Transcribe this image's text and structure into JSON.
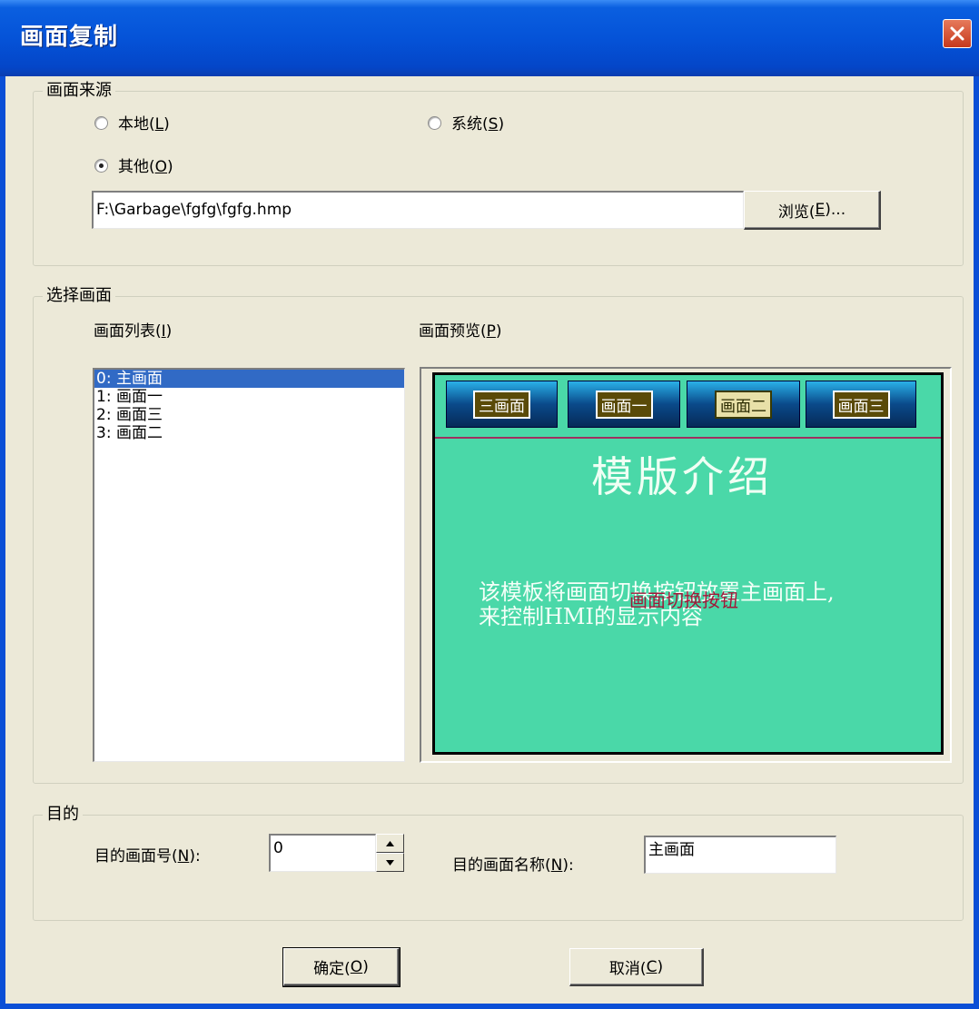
{
  "window": {
    "title": "画面复制",
    "close_icon": "close-icon"
  },
  "source": {
    "legend": "画面来源",
    "local": "本地(L)",
    "system": "系统(S)",
    "other": "其他(O)",
    "selected": "other",
    "path": "F:\\Garbage\\fgfg\\fgfg.hmp",
    "browse": "浏览(E)..."
  },
  "select": {
    "legend": "选择画面",
    "list_label": "画面列表(I)",
    "preview_label": "画面预览(P)",
    "items": [
      "0: 主画面",
      "1: 画面一",
      "2: 画面三",
      "3: 画面二"
    ],
    "selected_index": 0,
    "preview": {
      "nav": [
        "三画面",
        "画面一",
        "画面二",
        "画面三"
      ],
      "title": "模版介绍",
      "body_line1": "该模板将画面切换按钮放置主画面上,",
      "body_line2": "来控制HMI的显示内容",
      "overlay": "画面切换按钮"
    }
  },
  "dest": {
    "legend": "目的",
    "number_label": "目的画面号(N):",
    "number_value": "0",
    "name_label": "目的画面名称(N):",
    "name_value": "主画面"
  },
  "buttons": {
    "ok": "确定(O)",
    "cancel": "取消(C)"
  }
}
